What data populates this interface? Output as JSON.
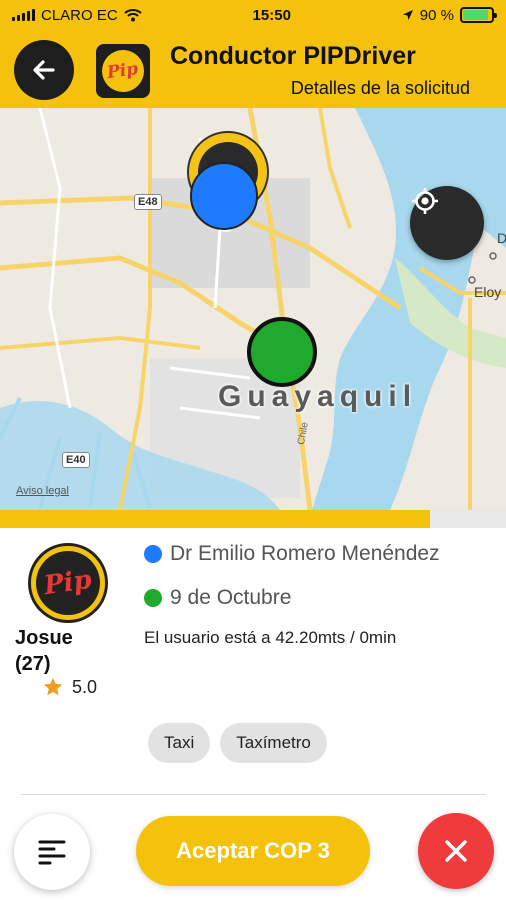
{
  "status_bar": {
    "carrier": "CLARO EC",
    "time": "15:50",
    "battery_percent": "90 %",
    "battery_level": 0.9,
    "icons": [
      "signal-icon",
      "wifi-icon",
      "location-arrow-icon",
      "battery-icon"
    ]
  },
  "header": {
    "back_icon": "back-arrow-icon",
    "logo_text": "Pip",
    "title": "Conductor PIPDriver",
    "subtitle": "Detalles de la solicitud"
  },
  "map": {
    "city_label": "Guayaquil",
    "road_shields": [
      "E48",
      "E40"
    ],
    "street_label": "Chile",
    "side_labels": [
      "D",
      "Eloy"
    ],
    "legal_text": "Aviso legal",
    "locate_icon": "crosshair-icon",
    "colors": {
      "origin": "#1E7BFF",
      "destination": "#1FAA2E",
      "water": "#A8D8EE",
      "road": "#F7D46A"
    }
  },
  "progress": {
    "level": 0.85,
    "color": "#F4C20D"
  },
  "request": {
    "user_logo_text": "Pip",
    "user_name": "Josue",
    "user_count": "(27)",
    "rating": "5.0",
    "origin": "Dr Emilio Romero Menéndez",
    "destination": "9 de Octubre",
    "distance_text": "El usuario está a 42.20mts / 0min",
    "tags": [
      "Taxi",
      "Taxímetro"
    ]
  },
  "actions": {
    "menu_icon": "menu-lines-icon",
    "accept_label": "Aceptar COP 3",
    "reject_icon": "close-icon"
  },
  "colors": {
    "brand": "#F4C20D",
    "dark": "#1E1E1E",
    "danger": "#EF3B3B"
  }
}
